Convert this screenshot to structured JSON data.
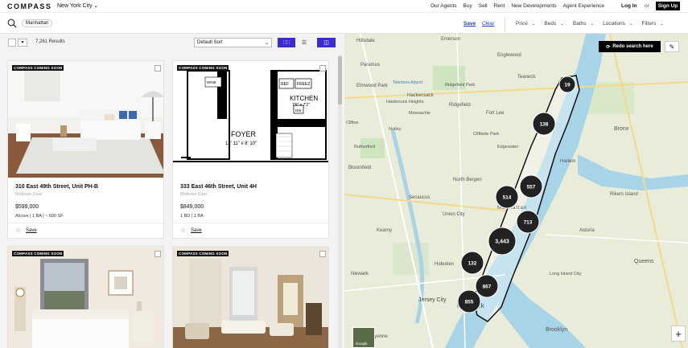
{
  "brand": {
    "logo": "COMPASS"
  },
  "nav": {
    "city": "New York City",
    "links": [
      "Our Agents",
      "Buy",
      "Sell",
      "Rent",
      "New Developments",
      "Agent Experience"
    ],
    "login": "Log In",
    "or": "or",
    "signup": "Sign Up"
  },
  "search": {
    "chip": "Manhattan",
    "save": "Save",
    "clear": "Clear",
    "filters": [
      "Price",
      "Beds",
      "Baths",
      "Locations",
      "Filters"
    ]
  },
  "toolbar": {
    "results": "7,261 Results",
    "sort": "Default Sort"
  },
  "cards": [
    {
      "badge": "COMPASS COMING SOON",
      "address": "310 East 49th Street, Unit PH-B",
      "neighborhood": "Midtown East",
      "price": "$599,000",
      "specs": "Alcove  |  1 BA  |  ~ 600 SF",
      "save": "Save"
    },
    {
      "badge": "COMPASS COMING SOON",
      "address": "333 East 46th Street, Unit 4H",
      "neighborhood": "Midtown East",
      "price": "$849,000",
      "specs": "1 BD  |  1 BA",
      "save": "Save"
    },
    {
      "badge": "COMPASS COMING SOON"
    },
    {
      "badge": "COMPASS COMING SOON"
    }
  ],
  "floorplan": {
    "rooms": [
      "REF",
      "FREEZ",
      "WINE",
      "KITCHEN",
      "7'6\" x 7'2\"",
      "DW",
      "FOYER",
      "12' 11\" x 8' 10\"",
      "PAN",
      "DISH"
    ]
  },
  "map": {
    "redo": "Redo search here",
    "zoom_in": "+",
    "google": "Google",
    "places": [
      "Hillsdale",
      "Emerson",
      "Teaneck",
      "Englewood",
      "Paramus",
      "Elmwood Park",
      "Teterboro Airport",
      "Ridgefield Park",
      "Hasbrouck Heights",
      "Hackensack",
      "Moonachie",
      "Clifton",
      "Ridgefield",
      "Cliffside Park",
      "Edgewater",
      "Nutley",
      "Rutherford",
      "Bloomfield",
      "North Bergen",
      "Secaucus",
      "Union City",
      "Kearny",
      "Hoboken",
      "Newark",
      "Jersey City",
      "New York",
      "Manhattan",
      "Rikers Island",
      "Astoria",
      "Queens",
      "Long Island City",
      "Bayonne",
      "Brooklyn",
      "Harlem",
      "Fort Lee",
      "Bronx"
    ],
    "clusters": [
      {
        "label": "19",
        "size": "s"
      },
      {
        "label": "138",
        "size": "m"
      },
      {
        "label": "557",
        "size": "m"
      },
      {
        "label": "514",
        "size": "m"
      },
      {
        "label": "713",
        "size": "m"
      },
      {
        "label": "3,443",
        "size": "l"
      },
      {
        "label": "132",
        "size": "m"
      },
      {
        "label": "867",
        "size": "m"
      },
      {
        "label": "855",
        "size": "m"
      }
    ]
  }
}
